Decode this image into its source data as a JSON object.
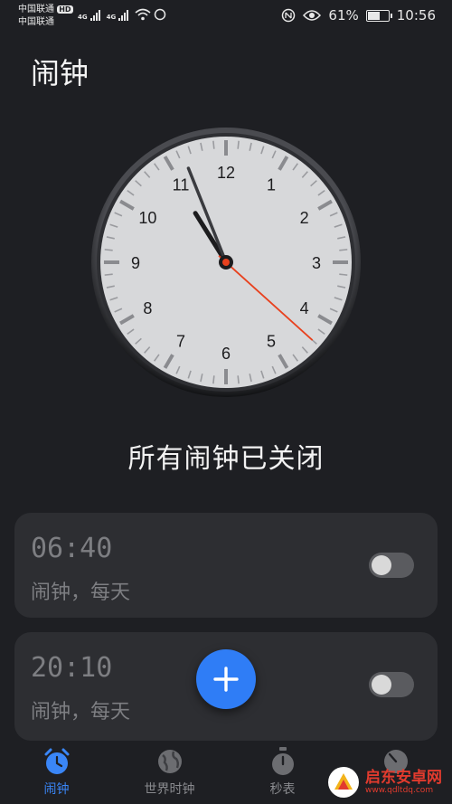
{
  "status_bar": {
    "carrier_1": "中国联通",
    "carrier_2": "中国联通",
    "hd_badge": "HD",
    "net_1": "4G",
    "net_2": "4G",
    "battery_percent": "61%",
    "battery_level": 0.61,
    "time": "10:56",
    "icons": [
      "nfc-icon",
      "eye-icon",
      "wifi-icon",
      "signal-icon"
    ]
  },
  "header": {
    "title": "闹钟"
  },
  "clock": {
    "numerals": [
      "12",
      "1",
      "2",
      "3",
      "4",
      "5",
      "6",
      "7",
      "8",
      "9",
      "10",
      "11"
    ],
    "hour": 10,
    "minute": 56,
    "second": 22,
    "colors": {
      "face": "#d7d8da",
      "rim": "#3a3b3f",
      "second_hand": "#e8411e",
      "hands": "#1c1c1e"
    }
  },
  "status_message": "所有闹钟已关闭",
  "alarms": [
    {
      "time": "06:40",
      "label": "闹钟，每天",
      "enabled": false
    },
    {
      "time": "20:10",
      "label": "闹钟，每天",
      "enabled": false
    }
  ],
  "fab": {
    "icon": "plus-icon",
    "color": "#2f7df6"
  },
  "bottom_nav": [
    {
      "label": "闹钟",
      "icon": "alarm-clock-icon",
      "active": true
    },
    {
      "label": "世界时钟",
      "icon": "globe-icon",
      "active": false
    },
    {
      "label": "秒表",
      "icon": "stopwatch-icon",
      "active": false
    },
    {
      "label": "",
      "icon": "timer-icon",
      "active": false
    }
  ],
  "watermark": {
    "text": "启东安卓网",
    "url": "www.qdltdq.com"
  },
  "colors": {
    "accent": "#3a86f7",
    "background": "#1e1f23",
    "card": "#2d2e32"
  }
}
